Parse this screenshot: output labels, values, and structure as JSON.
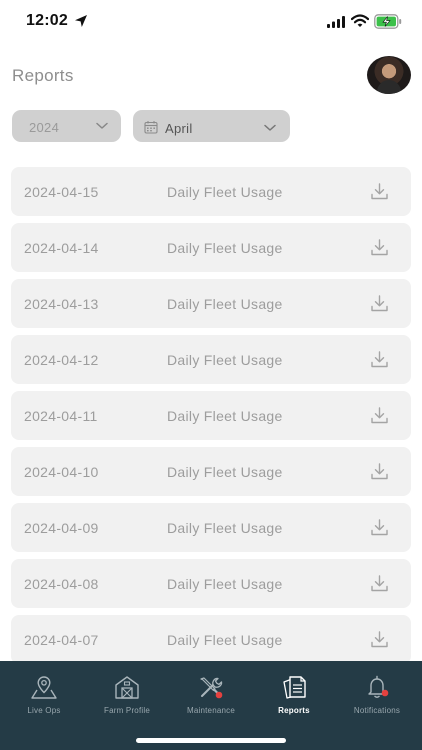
{
  "status_bar": {
    "time": "12:02",
    "icons": [
      "location-arrow-icon",
      "cellular-signal-icon",
      "wifi-icon",
      "battery-charging-icon"
    ]
  },
  "header": {
    "title": "Reports"
  },
  "filters": {
    "year": "2024",
    "month": "April"
  },
  "reports": [
    {
      "date": "2024-04-15",
      "name": "Daily Fleet Usage"
    },
    {
      "date": "2024-04-14",
      "name": "Daily Fleet Usage"
    },
    {
      "date": "2024-04-13",
      "name": "Daily Fleet Usage"
    },
    {
      "date": "2024-04-12",
      "name": "Daily Fleet Usage"
    },
    {
      "date": "2024-04-11",
      "name": "Daily Fleet Usage"
    },
    {
      "date": "2024-04-10",
      "name": "Daily Fleet Usage"
    },
    {
      "date": "2024-04-09",
      "name": "Daily Fleet Usage"
    },
    {
      "date": "2024-04-08",
      "name": "Daily Fleet Usage"
    },
    {
      "date": "2024-04-07",
      "name": "Daily Fleet Usage"
    }
  ],
  "nav": {
    "items": [
      {
        "label": "Live Ops",
        "icon": "map-pin-icon",
        "active": false,
        "badge": false
      },
      {
        "label": "Farm Profile",
        "icon": "barn-icon",
        "active": false,
        "badge": false
      },
      {
        "label": "Maintenance",
        "icon": "tools-icon",
        "active": false,
        "badge": true
      },
      {
        "label": "Reports",
        "icon": "documents-icon",
        "active": true,
        "badge": false
      },
      {
        "label": "Notifications",
        "icon": "bell-icon",
        "active": false,
        "badge": true
      }
    ]
  },
  "colors": {
    "nav_background": "#243b46",
    "badge": "#e5413f",
    "row_background": "#f1f1f1",
    "select_background": "#d0d0d0"
  }
}
